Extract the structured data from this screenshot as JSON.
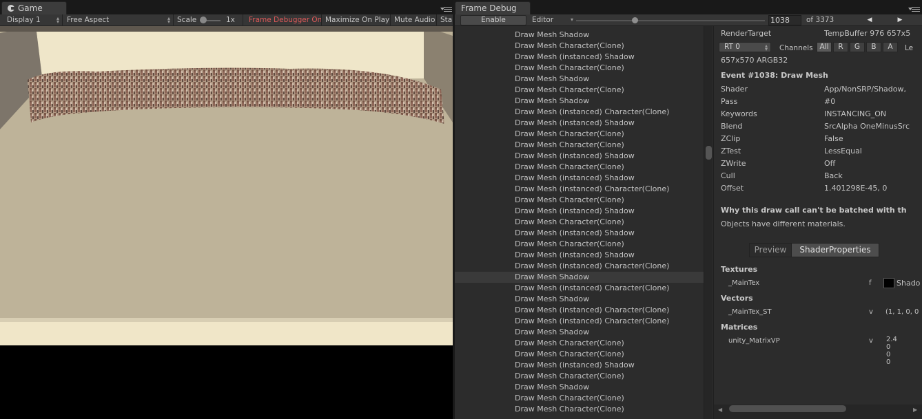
{
  "game": {
    "tab_title": "Game",
    "toolbar": {
      "display": "Display 1",
      "aspect": "Free Aspect",
      "scale_label": "Scale",
      "scale_value": "1x",
      "frame_debugger": "Frame Debugger On",
      "maximize": "Maximize On Play",
      "mute": "Mute Audio",
      "stats": "Sta"
    }
  },
  "frame_debug": {
    "tab_title": "Frame Debug",
    "toolbar": {
      "enable": "Enable",
      "target": "Editor",
      "current_event": "1038",
      "total": "of 3373",
      "prev_icon": "◀",
      "next_icon": "▶"
    },
    "events": [
      "Draw Mesh Shadow",
      "Draw Mesh Character(Clone)",
      "Draw Mesh (instanced) Shadow",
      "Draw Mesh Character(Clone)",
      "Draw Mesh Shadow",
      "Draw Mesh Character(Clone)",
      "Draw Mesh Shadow",
      "Draw Mesh (instanced) Character(Clone)",
      "Draw Mesh (instanced) Shadow",
      "Draw Mesh Character(Clone)",
      "Draw Mesh Character(Clone)",
      "Draw Mesh (instanced) Shadow",
      "Draw Mesh Character(Clone)",
      "Draw Mesh (instanced) Shadow",
      "Draw Mesh (instanced) Character(Clone)",
      "Draw Mesh Character(Clone)",
      "Draw Mesh (instanced) Shadow",
      "Draw Mesh Character(Clone)",
      "Draw Mesh (instanced) Shadow",
      "Draw Mesh Character(Clone)",
      "Draw Mesh (instanced) Shadow",
      "Draw Mesh (instanced) Character(Clone)",
      "Draw Mesh Shadow",
      "Draw Mesh (instanced) Character(Clone)",
      "Draw Mesh Shadow",
      "Draw Mesh (instanced) Character(Clone)",
      "Draw Mesh (instanced) Character(Clone)",
      "Draw Mesh Shadow",
      "Draw Mesh Character(Clone)",
      "Draw Mesh Character(Clone)",
      "Draw Mesh (instanced) Shadow",
      "Draw Mesh Character(Clone)",
      "Draw Mesh Shadow",
      "Draw Mesh Character(Clone)",
      "Draw Mesh Character(Clone)"
    ],
    "selected_event_index": 22,
    "details": {
      "render_target_label": "RenderTarget",
      "render_target_value": "TempBuffer 976 657x5",
      "rt_select": "RT 0",
      "channels_label": "Channels",
      "channels": [
        "All",
        "R",
        "G",
        "B",
        "A"
      ],
      "levels_label": "Le",
      "format": "657x570 ARGB32",
      "event_title": "Event #1038: Draw Mesh",
      "props": [
        {
          "label": "Shader",
          "value": "App/NonSRP/Shadow,"
        },
        {
          "label": "Pass",
          "value": "#0"
        },
        {
          "label": "Keywords",
          "value": "INSTANCING_ON"
        },
        {
          "label": "Blend",
          "value": "SrcAlpha OneMinusSrc"
        },
        {
          "label": "ZClip",
          "value": "False"
        },
        {
          "label": "ZTest",
          "value": "LessEqual"
        },
        {
          "label": "ZWrite",
          "value": "Off"
        },
        {
          "label": "Cull",
          "value": "Back"
        },
        {
          "label": "Offset",
          "value": "1.401298E-45, 0"
        }
      ],
      "batch_heading": "Why this draw call can't be batched with th",
      "batch_reason": "Objects have different materials.",
      "tab_preview": "Preview",
      "tab_shader_props": "ShaderProperties",
      "textures_heading": "Textures",
      "texture_name": "_MainTex",
      "texture_stage": "f",
      "texture_value": "Shado",
      "vectors_heading": "Vectors",
      "vector_name": "_MainTex_ST",
      "vector_stage": "v",
      "vector_value": "(1, 1, 0, 0",
      "matrices_heading": "Matrices",
      "matrix_name": "unity_MatrixVP",
      "matrix_stage": "v",
      "matrix_values": [
        "2.4",
        "0",
        "0",
        "0"
      ]
    }
  }
}
